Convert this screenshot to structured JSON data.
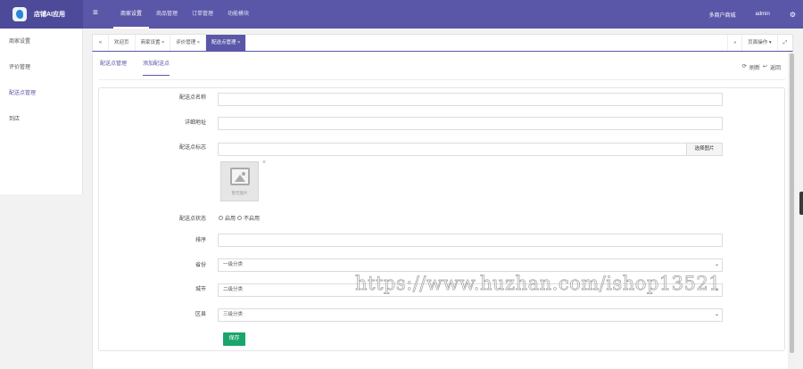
{
  "brand": {
    "name": "店铺AI应用"
  },
  "topbar": {
    "menu_icon": "menu-icon",
    "nav": [
      "商家设置",
      "商品管理",
      "订单管理",
      "功能模块"
    ],
    "active_nav": 0,
    "right": {
      "multi_merchant": "多商户商城",
      "user": "admin",
      "settings_icon": "gear-icon"
    }
  },
  "sidebar": {
    "items": [
      "商家设置",
      "评价管理",
      "配送点管理",
      "到店"
    ],
    "active": 2
  },
  "tabs": {
    "items": [
      "欢迎页",
      "商家设置 ×",
      "评价管理 ×",
      "配送点管理 ×"
    ],
    "active": 3,
    "page_ops": "页面操作 ▾",
    "left_arrow": "«",
    "right_arrow": "»",
    "fullscreen": "⤢"
  },
  "subtabs": {
    "list": "配送点管理",
    "add": "添加配送点"
  },
  "actions": {
    "refresh": "刷新",
    "back": "返回"
  },
  "form": {
    "name_label": "配送点名称",
    "address_label": "详细地址",
    "logo_label": "配送点标志",
    "upload_button": "选择图片",
    "no_image": "暂无图片",
    "remove_image": "×",
    "status_label": "配送点状态",
    "status_options": [
      "启用",
      "不启用"
    ],
    "sort_label": "排序",
    "province_label": "省份",
    "province_value": "一级分类",
    "city_label": "城市",
    "city_value": "二级分类",
    "district_label": "区县",
    "district_value": "三级分类",
    "save_button": "保存"
  },
  "watermark": "https://www.huzhan.com/ishop13521"
}
